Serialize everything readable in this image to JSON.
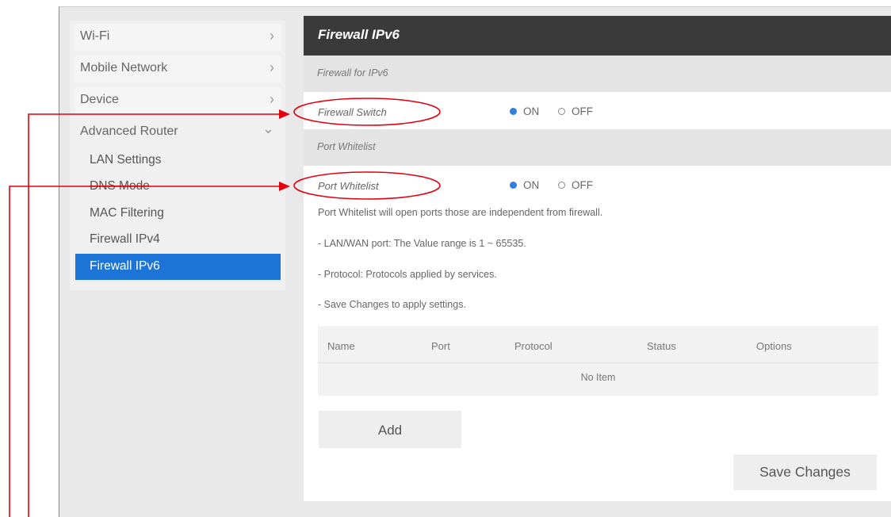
{
  "sidebar": {
    "menu": [
      {
        "label": "Wi-Fi",
        "chevron": "›"
      },
      {
        "label": "Mobile Network",
        "chevron": "›"
      },
      {
        "label": "Device",
        "chevron": "›"
      },
      {
        "label": "Advanced Router",
        "chevron": "⌄"
      }
    ],
    "submenu": [
      {
        "label": "LAN Settings"
      },
      {
        "label": "DNS Mode"
      },
      {
        "label": "MAC Filtering"
      },
      {
        "label": "Firewall IPv4"
      },
      {
        "label": "Firewall IPv6",
        "active": true
      }
    ]
  },
  "main": {
    "title": "Firewall IPv6",
    "section1": "Firewall for IPv6",
    "firewall_switch": {
      "label": "Firewall Switch",
      "on": "ON",
      "off": "OFF",
      "selected": "ON"
    },
    "section2": "Port Whitelist",
    "port_whitelist": {
      "label": "Port Whitelist",
      "on": "ON",
      "off": "OFF",
      "selected": "ON"
    },
    "info": [
      "Port Whitelist will open ports those are independent from firewall.",
      "- LAN/WAN port: The Value range is 1 ~ 65535.",
      "- Protocol: Protocols applied by services.",
      "- Save Changes to apply settings."
    ],
    "table": {
      "headers": [
        "Name",
        "Port",
        "Protocol",
        "Status",
        "Options"
      ],
      "empty": "No Item"
    },
    "add_label": "Add",
    "save_label": "Save Changes"
  },
  "colors": {
    "accent": "#1b74d6",
    "header": "#3a3a3a",
    "annotation": "#e3000f",
    "radio_on": "#2f7fe0"
  }
}
